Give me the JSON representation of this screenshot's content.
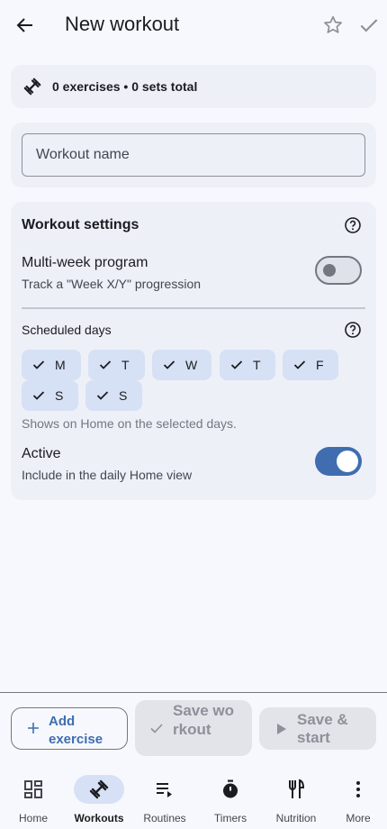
{
  "appbar": {
    "title": "New workout"
  },
  "summary": {
    "text": "0 exercises • 0 sets total"
  },
  "name": {
    "value": "",
    "placeholder": "Workout name"
  },
  "settings": {
    "title": "Workout settings",
    "multi_week": {
      "title": "Multi-week program",
      "subtitle": "Track a \"Week X/Y\" progression",
      "enabled": false
    },
    "scheduled": {
      "title": "Scheduled days",
      "days": [
        {
          "label": "M",
          "selected": true
        },
        {
          "label": "T",
          "selected": true
        },
        {
          "label": "W",
          "selected": true
        },
        {
          "label": "T",
          "selected": true
        },
        {
          "label": "F",
          "selected": true
        },
        {
          "label": "S",
          "selected": true
        },
        {
          "label": "S",
          "selected": true
        }
      ],
      "hint": "Shows on Home on the selected days."
    },
    "active": {
      "title": "Active",
      "subtitle": "Include in the daily Home view",
      "enabled": true
    }
  },
  "actions": {
    "add_exercise": "Add exercise",
    "save_workout": "Save workout",
    "save_start": "Save & start"
  },
  "nav": {
    "items": [
      {
        "label": "Home",
        "icon": "dashboard-icon"
      },
      {
        "label": "Workouts",
        "icon": "fitness-icon",
        "active": true
      },
      {
        "label": "Routines",
        "icon": "playlist-play-icon"
      },
      {
        "label": "Timers",
        "icon": "timer-icon"
      },
      {
        "label": "Nutrition",
        "icon": "restaurant-icon"
      },
      {
        "label": "More",
        "icon": "more-vert-icon"
      }
    ]
  },
  "colors": {
    "accent": "#3f6db0",
    "chip": "#d7e1f5",
    "background": "#f7f8fd",
    "card": "#eef0f8"
  }
}
